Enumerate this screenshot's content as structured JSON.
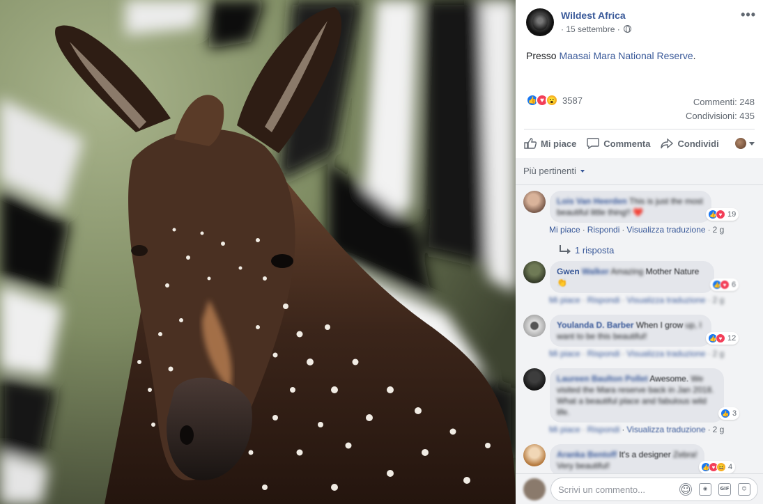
{
  "post": {
    "page_name": "Wildest Africa",
    "date": "· 15 settembre ·",
    "text_prefix": "Presso ",
    "location": "Maasai Mara National Reserve",
    "text_suffix": ".",
    "reaction_count": "3587",
    "comments": "Commenti: 248",
    "shares": "Condivisioni: 435",
    "more_icon": "more-dots-icon"
  },
  "actions": {
    "like": "Mi piace",
    "comment": "Commenta",
    "share": "Condividi"
  },
  "sort_label": "Più pertinenti",
  "comments": [
    {
      "author": "Lois Van Heerden",
      "text": "This is just the most beautiful little thing!! ❤️",
      "reaction_count": "19",
      "like": "Mi piace",
      "reply": "Rispondi",
      "translate": "Visualizza traduzione",
      "age": "2 g",
      "replies": "1 risposta"
    },
    {
      "author_visible": "Gwen",
      "author_blurred": "Walker",
      "text_blurred": "Amazing",
      "text": "Mother Nature 👏",
      "reaction_count": "6",
      "like": "Mi piace",
      "reply": "Rispondi",
      "translate": "Visualizza traduzione",
      "age": "2 g"
    },
    {
      "author": "Youlanda D. Barber",
      "text_visible": "When I grow",
      "text_blurred": "up, I want to be this beautiful!",
      "reaction_count": "12",
      "like": "Mi piace",
      "reply": "Rispondi",
      "translate": "Visualizza traduzione",
      "age": "2 g"
    },
    {
      "author": "Laureen Baulton Pollet",
      "text_visible": "Awesome.",
      "text_blurred": "We visited the Mara reserve back in Jan 2018. What a beautiful place and fabulous wild life.",
      "reaction_count": "3",
      "like": "Mi piace",
      "reply": "Rispondi",
      "translate": "Visualizza traduzione",
      "age": "2 g"
    },
    {
      "author": "Aranka Bentoff",
      "text_visible": "It's a designer",
      "text_blurred": "Zebra! Very beautiful!",
      "reaction_count": "4"
    }
  ],
  "composer": {
    "placeholder": "Scrivi un commento..."
  },
  "colors": {
    "link": "#385898",
    "like": "#1877f2",
    "love": "#f33e58",
    "wow": "#f7b125",
    "comments_bg": "#f2f3f5"
  }
}
